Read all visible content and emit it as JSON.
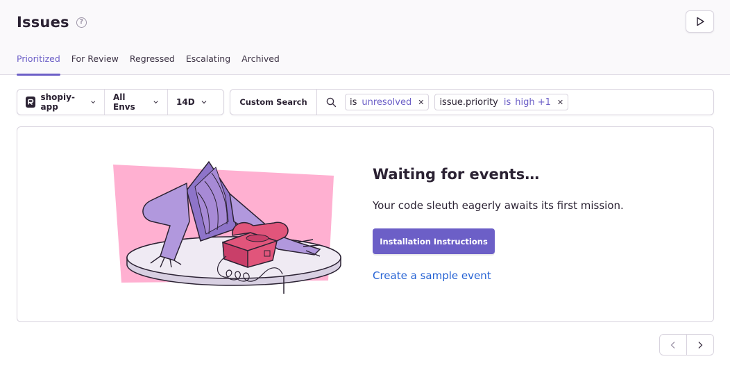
{
  "header": {
    "title": "Issues",
    "help_glyph": "?"
  },
  "tabs": [
    {
      "label": "Prioritized",
      "active": true
    },
    {
      "label": "For Review",
      "active": false
    },
    {
      "label": "Regressed",
      "active": false
    },
    {
      "label": "Escalating",
      "active": false
    },
    {
      "label": "Archived",
      "active": false
    }
  ],
  "filters": {
    "project": "shopiy-app",
    "environment": "All Envs",
    "date_range": "14D"
  },
  "search": {
    "custom_search_label": "Custom Search",
    "tokens": [
      {
        "key": "is",
        "value": "unresolved"
      },
      {
        "key": "issue.priority",
        "operator": "is",
        "value": "high +1"
      }
    ]
  },
  "empty_state": {
    "title": "Waiting for events…",
    "description": "Your code sleuth eagerly awaits its first mission.",
    "primary_button": "Installation Instructions",
    "secondary_link": "Create a sample event"
  },
  "colors": {
    "accent": "#6c5fc7",
    "link": "#2562d4",
    "illustration_pink": "#ffb0d1",
    "phone_red": "#e1557b"
  },
  "icons": {
    "help": "help-circle-icon",
    "play": "play-icon",
    "project": "project-badge-icon",
    "search": "search-icon",
    "remove": "close-icon",
    "prev": "chevron-left-icon",
    "next": "chevron-right-icon"
  }
}
